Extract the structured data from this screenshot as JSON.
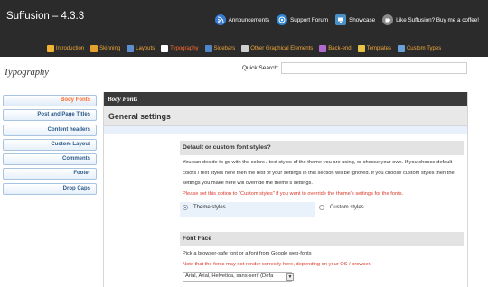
{
  "header": {
    "title": "Suffusion – 4.3.3",
    "links": [
      {
        "label": "Announcements",
        "icon": "rss-icon"
      },
      {
        "label": "Support Forum",
        "icon": "support-icon"
      },
      {
        "label": "Showcase",
        "icon": "showcase-icon"
      },
      {
        "label": "Like Suffusion? Buy me a coffee!",
        "icon": "coffee-icon"
      }
    ],
    "nav": [
      {
        "label": "Introduction",
        "icon": "intro-icon"
      },
      {
        "label": "Skinning",
        "icon": "skinning-icon"
      },
      {
        "label": "Layouts",
        "icon": "layouts-icon"
      },
      {
        "label": "Typography",
        "icon": "typography-icon",
        "active": true
      },
      {
        "label": "Sidebars",
        "icon": "sidebars-icon"
      },
      {
        "label": "Other Graphical Elements",
        "icon": "graphics-icon"
      },
      {
        "label": "Back-end",
        "icon": "backend-icon"
      },
      {
        "label": "Templates",
        "icon": "templates-icon"
      },
      {
        "label": "Custom Types",
        "icon": "custom-types-icon"
      }
    ]
  },
  "page": {
    "title": "Typography",
    "quick_search_label": "Quick Search:",
    "quick_search_value": ""
  },
  "sidebar": {
    "items": [
      {
        "label": "Body Fonts",
        "active": true
      },
      {
        "label": "Post and Page Titles"
      },
      {
        "label": "Content headers"
      },
      {
        "label": "Custom Layout"
      },
      {
        "label": "Comments"
      },
      {
        "label": "Footer"
      },
      {
        "label": "Drop Caps"
      }
    ]
  },
  "main": {
    "section_title": "Body Fonts",
    "group_title": "General settings",
    "setting1": {
      "title": "Default or custom font styles?",
      "desc": "You can decide to go with the colors / text styles of the theme you are using, or choose your own. If you choose default colors / text styles here then the rest of your settings in this section will be ignored. If you choose custom styles then the settings you make here will override the theme's settings.",
      "warning": "Please set this option to \"Custom styles\" if you want to override the theme's settings for the fonts.",
      "option_theme": "Theme styles",
      "option_custom": "Custom styles"
    },
    "setting2": {
      "title": "Font Face",
      "desc": "Pick a browser-safe font or a font from Google web-fonts",
      "warning": "Note that the fonts may not render correctly here, depending on your OS / browser.",
      "select_value": "Arial, Arial, Helvetica, sans-serif (Defa"
    }
  },
  "colors": {
    "topbar": "#2b2b2b",
    "nav_link": "#f0a63a",
    "active": "#ff6a2a",
    "warning": "#d83a2a",
    "sidebar_text": "#2b5a8a"
  }
}
